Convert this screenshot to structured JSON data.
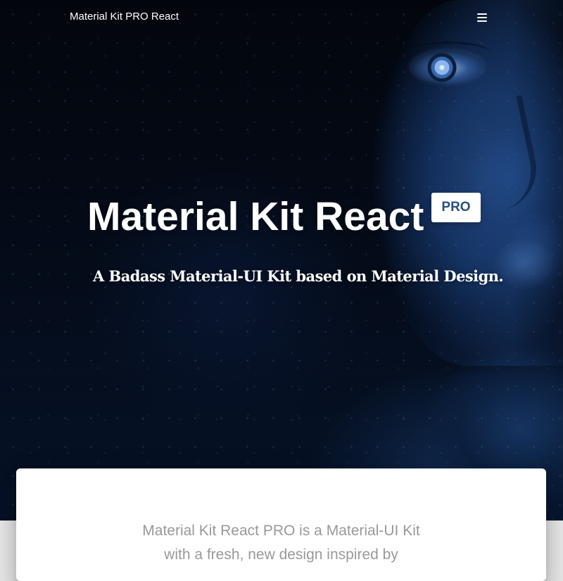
{
  "navbar": {
    "brand": "Material Kit PRO React",
    "menu_icon": "menu-icon"
  },
  "hero": {
    "title": "Material Kit React",
    "badge": "PRO",
    "subtitle": "A Badass Material-UI Kit based on Material Design.",
    "colors": {
      "background": "#040b18",
      "text": "#ffffff",
      "badge_text": "#2b4f7f"
    }
  },
  "main": {
    "intro_lines": [
      "Material Kit React PRO is a Material-UI Kit",
      "with a fresh, new design inspired by"
    ],
    "colors": {
      "card": "#ffffff",
      "text": "#999999"
    }
  }
}
